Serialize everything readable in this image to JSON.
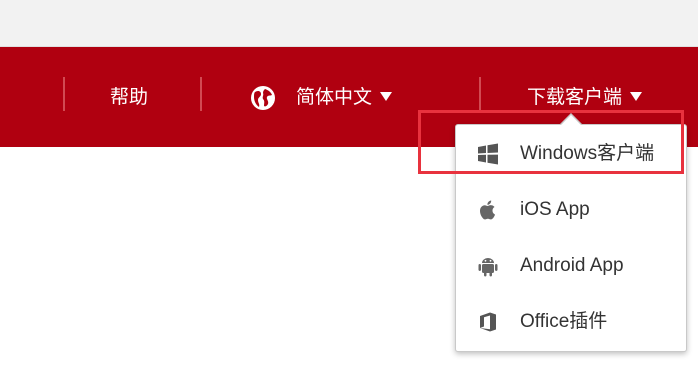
{
  "nav": {
    "help_label": "帮助",
    "language_label": "简体中文",
    "download_label": "下载客户端"
  },
  "download_menu": {
    "items": [
      {
        "label": "Windows客户端",
        "icon": "windows-icon"
      },
      {
        "label": "iOS App",
        "icon": "apple-icon"
      },
      {
        "label": "Android App",
        "icon": "android-icon"
      },
      {
        "label": "Office插件",
        "icon": "office-icon"
      }
    ]
  },
  "colors": {
    "navbar_bg": "#b00010",
    "highlight_border": "#e8323e",
    "menu_text": "#333333"
  }
}
